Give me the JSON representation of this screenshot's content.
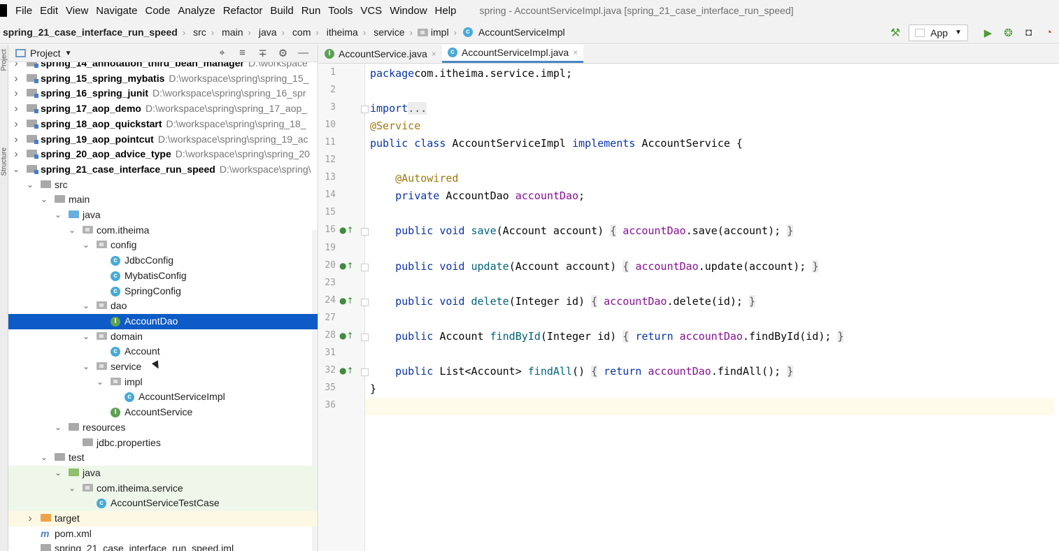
{
  "window_title": "spring - AccountServiceImpl.java [spring_21_case_interface_run_speed]",
  "menu": [
    "File",
    "Edit",
    "View",
    "Navigate",
    "Code",
    "Analyze",
    "Refactor",
    "Build",
    "Run",
    "Tools",
    "VCS",
    "Window",
    "Help"
  ],
  "breadcrumb": [
    "spring_21_case_interface_run_speed",
    "src",
    "main",
    "java",
    "com",
    "itheima",
    "service",
    "impl",
    "AccountServiceImpl"
  ],
  "run_config": {
    "label": "App"
  },
  "project_panel": {
    "title": "Project"
  },
  "tree": [
    {
      "depth": 0,
      "arrow": "right",
      "icon": "module",
      "name": "spring_14_annotation_third_bean_manager",
      "path": "D:\\workspace",
      "bold": true
    },
    {
      "depth": 0,
      "arrow": "right",
      "icon": "module",
      "name": "spring_15_spring_mybatis",
      "path": "D:\\workspace\\spring\\spring_15_",
      "bold": true
    },
    {
      "depth": 0,
      "arrow": "right",
      "icon": "module",
      "name": "spring_16_spring_junit",
      "path": "D:\\workspace\\spring\\spring_16_spr",
      "bold": true
    },
    {
      "depth": 0,
      "arrow": "right",
      "icon": "module",
      "name": "spring_17_aop_demo",
      "path": "D:\\workspace\\spring\\spring_17_aop_",
      "bold": true
    },
    {
      "depth": 0,
      "arrow": "right",
      "icon": "module",
      "name": "spring_18_aop_quickstart",
      "path": "D:\\workspace\\spring\\spring_18_",
      "bold": true
    },
    {
      "depth": 0,
      "arrow": "right",
      "icon": "module",
      "name": "spring_19_aop_pointcut",
      "path": "D:\\workspace\\spring\\spring_19_ac",
      "bold": true
    },
    {
      "depth": 0,
      "arrow": "right",
      "icon": "module",
      "name": "spring_20_aop_advice_type",
      "path": "D:\\workspace\\spring\\spring_20",
      "bold": true
    },
    {
      "depth": 0,
      "arrow": "down",
      "icon": "module",
      "name": "spring_21_case_interface_run_speed",
      "path": "D:\\workspace\\spring\\",
      "bold": true
    },
    {
      "depth": 1,
      "arrow": "down",
      "icon": "folder",
      "name": "src"
    },
    {
      "depth": 2,
      "arrow": "down",
      "icon": "folder",
      "name": "main"
    },
    {
      "depth": 3,
      "arrow": "down",
      "icon": "folder-blue",
      "name": "java"
    },
    {
      "depth": 4,
      "arrow": "down",
      "icon": "package",
      "name": "com.itheima"
    },
    {
      "depth": 5,
      "arrow": "down",
      "icon": "package",
      "name": "config"
    },
    {
      "depth": 6,
      "arrow": "",
      "icon": "class",
      "name": "JdbcConfig"
    },
    {
      "depth": 6,
      "arrow": "",
      "icon": "class",
      "name": "MybatisConfig"
    },
    {
      "depth": 6,
      "arrow": "",
      "icon": "class",
      "name": "SpringConfig"
    },
    {
      "depth": 5,
      "arrow": "down",
      "icon": "package",
      "name": "dao"
    },
    {
      "depth": 6,
      "arrow": "",
      "icon": "interface",
      "name": "AccountDao",
      "selected": true
    },
    {
      "depth": 5,
      "arrow": "down",
      "icon": "package",
      "name": "domain"
    },
    {
      "depth": 6,
      "arrow": "",
      "icon": "class",
      "name": "Account"
    },
    {
      "depth": 5,
      "arrow": "down",
      "icon": "package",
      "name": "service"
    },
    {
      "depth": 6,
      "arrow": "down",
      "icon": "package",
      "name": "impl"
    },
    {
      "depth": 7,
      "arrow": "",
      "icon": "class",
      "name": "AccountServiceImpl"
    },
    {
      "depth": 6,
      "arrow": "",
      "icon": "interface",
      "name": "AccountService"
    },
    {
      "depth": 3,
      "arrow": "down",
      "icon": "folder",
      "name": "resources"
    },
    {
      "depth": 4,
      "arrow": "",
      "icon": "properties",
      "name": "jdbc.properties"
    },
    {
      "depth": 2,
      "arrow": "down",
      "icon": "folder",
      "name": "test"
    },
    {
      "depth": 3,
      "arrow": "down",
      "icon": "folder-green",
      "name": "java",
      "test": true
    },
    {
      "depth": 4,
      "arrow": "down",
      "icon": "package",
      "name": "com.itheima.service",
      "test": true
    },
    {
      "depth": 5,
      "arrow": "",
      "icon": "class-test",
      "name": "AccountServiceTestCase",
      "test": true
    },
    {
      "depth": 1,
      "arrow": "right",
      "icon": "folder-orange",
      "name": "target",
      "excluded": true
    },
    {
      "depth": 1,
      "arrow": "",
      "icon": "maven",
      "name": "pom.xml"
    },
    {
      "depth": 1,
      "arrow": "",
      "icon": "iml",
      "name": "spring_21_case_interface_run_speed.iml"
    }
  ],
  "editor": {
    "tabs": [
      {
        "label": "AccountService.java",
        "icon": "interface",
        "active": false
      },
      {
        "label": "AccountServiceImpl.java",
        "icon": "class",
        "active": true
      }
    ],
    "lines": [
      {
        "n": "1",
        "tokens": [
          [
            "kw",
            "package"
          ],
          [
            "",
            "com.itheima.service.impl;"
          ]
        ]
      },
      {
        "n": "2",
        "tokens": []
      },
      {
        "n": "3",
        "fold": true,
        "tokens": [
          [
            "kw",
            "import"
          ],
          [
            "",
            ""
          ],
          [
            "fd",
            "..."
          ]
        ]
      },
      {
        "n": "10",
        "tokens": [
          [
            "ann",
            "@Service"
          ]
        ]
      },
      {
        "n": "11",
        "tokens": [
          [
            "kw",
            "public class"
          ],
          [
            "",
            " AccountServiceImpl "
          ],
          [
            "kw",
            "implements"
          ],
          [
            "",
            " AccountService {"
          ]
        ]
      },
      {
        "n": "12",
        "tokens": []
      },
      {
        "n": "13",
        "tokens": [
          [
            "",
            "    "
          ],
          [
            "ann",
            "@Autowired"
          ]
        ]
      },
      {
        "n": "14",
        "tokens": [
          [
            "",
            "    "
          ],
          [
            "kw",
            "private"
          ],
          [
            "",
            " AccountDao "
          ],
          [
            "fld",
            "accountDao"
          ],
          [
            "",
            ";"
          ]
        ]
      },
      {
        "n": "15",
        "tokens": []
      },
      {
        "n": "16",
        "impl": true,
        "fold": true,
        "tokens": [
          [
            "",
            "    "
          ],
          [
            "kw",
            "public void"
          ],
          [
            " mth",
            "save"
          ],
          [
            "",
            "(Account account) "
          ],
          [
            "fd",
            "{"
          ],
          [
            "",
            " "
          ],
          [
            "fld",
            "accountDao"
          ],
          [
            "",
            ".save(account); "
          ],
          [
            "fd",
            "}"
          ]
        ]
      },
      {
        "n": "19",
        "tokens": []
      },
      {
        "n": "20",
        "impl": true,
        "fold": true,
        "tokens": [
          [
            "",
            "    "
          ],
          [
            "kw",
            "public void"
          ],
          [
            " mth",
            "update"
          ],
          [
            "",
            "(Account account) "
          ],
          [
            "fd",
            "{"
          ],
          [
            "",
            " "
          ],
          [
            "fld",
            "accountDao"
          ],
          [
            "",
            ".update(account); "
          ],
          [
            "fd",
            "}"
          ]
        ]
      },
      {
        "n": "23",
        "tokens": []
      },
      {
        "n": "24",
        "impl": true,
        "fold": true,
        "tokens": [
          [
            "",
            "    "
          ],
          [
            "kw",
            "public void"
          ],
          [
            " mth",
            "delete"
          ],
          [
            "",
            "(Integer id) "
          ],
          [
            "fd",
            "{"
          ],
          [
            "",
            " "
          ],
          [
            "fld",
            "accountDao"
          ],
          [
            "",
            ".delete(id); "
          ],
          [
            "fd",
            "}"
          ]
        ]
      },
      {
        "n": "27",
        "tokens": []
      },
      {
        "n": "28",
        "impl": true,
        "fold": true,
        "tokens": [
          [
            "",
            "    "
          ],
          [
            "kw",
            "public"
          ],
          [
            "",
            " Account "
          ],
          [
            "mth",
            "findById"
          ],
          [
            "",
            "(Integer id) "
          ],
          [
            "fd",
            "{"
          ],
          [
            "",
            " "
          ],
          [
            "kw",
            "return"
          ],
          [
            "",
            " "
          ],
          [
            "fld",
            "accountDao"
          ],
          [
            "",
            ".findById(id); "
          ],
          [
            "fd",
            "}"
          ]
        ]
      },
      {
        "n": "31",
        "tokens": []
      },
      {
        "n": "32",
        "impl": true,
        "fold": true,
        "tokens": [
          [
            "",
            "    "
          ],
          [
            "kw",
            "public"
          ],
          [
            "",
            " List<Account> "
          ],
          [
            "mth",
            "findAll"
          ],
          [
            "",
            "() "
          ],
          [
            "fd",
            "{"
          ],
          [
            "",
            " "
          ],
          [
            "kw",
            "return"
          ],
          [
            "",
            " "
          ],
          [
            "fld",
            "accountDao"
          ],
          [
            "",
            ".findAll(); "
          ],
          [
            "fd",
            "}"
          ]
        ]
      },
      {
        "n": "35",
        "tokens": [
          [
            "",
            "}"
          ]
        ]
      },
      {
        "n": "36",
        "current": true,
        "tokens": []
      }
    ]
  },
  "colors": {
    "selection": "#0d5bc6",
    "keyword": "#0a33a8",
    "annotation": "#9b7b10",
    "field": "#871094",
    "method": "#00627a"
  }
}
